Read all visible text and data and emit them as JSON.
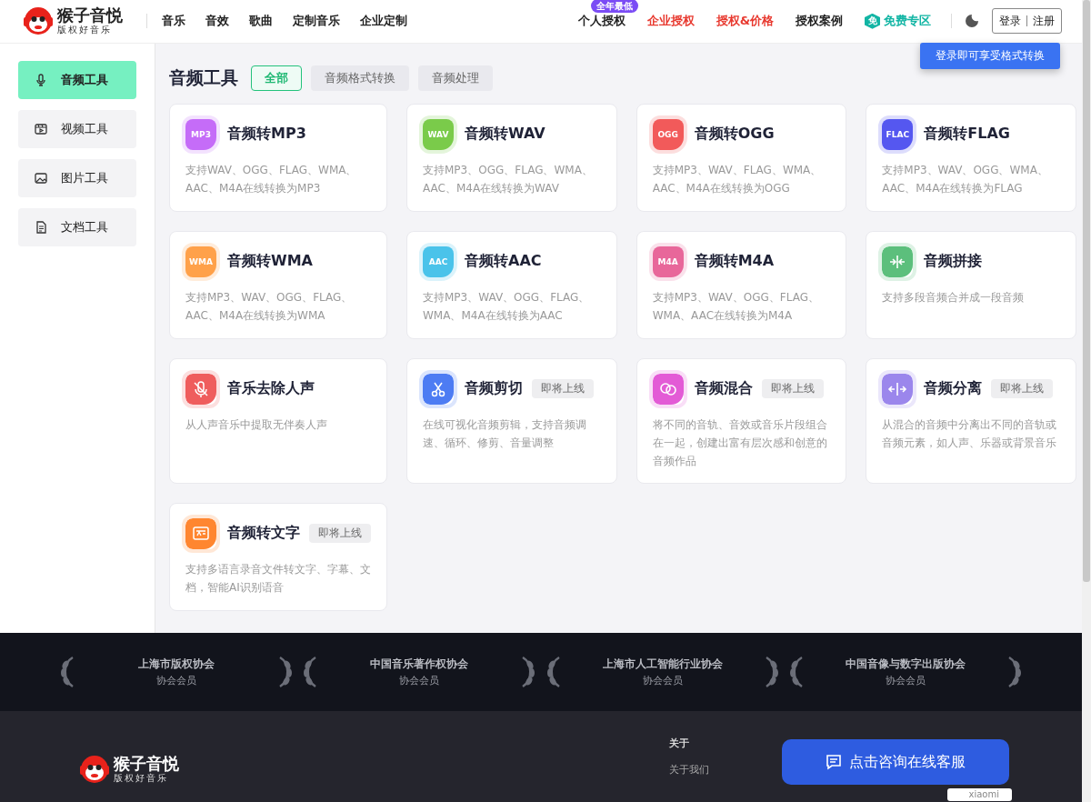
{
  "header": {
    "logo": {
      "name": "猴子音悦",
      "slogan": "版权好音乐"
    },
    "nav": [
      "音乐",
      "音效",
      "歌曲",
      "定制音乐",
      "企业定制"
    ],
    "right_nav": [
      {
        "label": "个人授权",
        "color": "#222222",
        "badge": "全年最低"
      },
      {
        "label": "企业授权",
        "color": "#e8392f"
      },
      {
        "label": "授权&价格",
        "color": "#e8392f"
      },
      {
        "label": "授权案例",
        "color": "#222222"
      },
      {
        "label": "免费专区",
        "color": "#12b5a4",
        "icon_text": "免"
      }
    ],
    "login": "登录",
    "register": "注册",
    "tooltip": "登录即可享受格式转换"
  },
  "sidebar": {
    "items": [
      {
        "label": "音频工具",
        "selected": true
      },
      {
        "label": "视频工具",
        "selected": false
      },
      {
        "label": "图片工具",
        "selected": false
      },
      {
        "label": "文档工具",
        "selected": false
      }
    ]
  },
  "main": {
    "title": "音频工具",
    "filters": [
      {
        "label": "全部",
        "selected": true
      },
      {
        "label": "音频格式转换",
        "selected": false
      },
      {
        "label": "音频处理",
        "selected": false
      }
    ],
    "tools": [
      {
        "kind": "format",
        "badge": "MP3",
        "color": "#c56cf8",
        "title": "音频转MP3",
        "description": "支持WAV、OGG、FLAG、WMA、AAC、M4A在线转换为MP3"
      },
      {
        "kind": "format",
        "badge": "WAV",
        "color": "#7acb4a",
        "title": "音频转WAV",
        "description": "支持MP3、OGG、FLAG、WMA、AAC、M4A在线转换为WAV"
      },
      {
        "kind": "format",
        "badge": "OGG",
        "color": "#f25a5a",
        "title": "音频转OGG",
        "description": "支持MP3、WAV、FLAG、WMA、AAC、M4A在线转换为OGG"
      },
      {
        "kind": "format",
        "badge": "FLAC",
        "color": "#5557f0",
        "title": "音频转FLAG",
        "description": "支持MP3、WAV、OGG、WMA、AAC、M4A在线转换为FLAG"
      },
      {
        "kind": "format",
        "badge": "WMA",
        "color": "#ffa14a",
        "title": "音频转WMA",
        "description": "支持MP3、WAV、OGG、FLAG、AAC、M4A在线转换为WMA"
      },
      {
        "kind": "format",
        "badge": "AAC",
        "color": "#4ac3ea",
        "title": "音频转AAC",
        "description": "支持MP3、WAV、OGG、FLAG、WMA、M4A在线转换为AAC"
      },
      {
        "kind": "format",
        "badge": "M4A",
        "color": "#e8679a",
        "title": "音频转M4A",
        "description": "支持MP3、WAV、OGG、FLAG、WMA、AAC在线转换为M4A"
      },
      {
        "kind": "splice",
        "color": "#5cbf7c",
        "title": "音频拼接",
        "description": "支持多段音频合并成一段音频"
      },
      {
        "kind": "vocal-remove",
        "color": "#ef5d5d",
        "title": "音乐去除人声",
        "description": "从人声音乐中提取无伴奏人声"
      },
      {
        "kind": "cut",
        "color": "#4d7cf3",
        "title": "音频剪切",
        "status": "即将上线",
        "description": "在线可视化音频剪辑，支持音频调速、循环、修剪、音量调整"
      },
      {
        "kind": "mix",
        "color": "#e35bd6",
        "title": "音频混合",
        "status": "即将上线",
        "description": "将不同的音轨、音效或音乐片段组合在一起，创建出富有层次感和创意的音频作品"
      },
      {
        "kind": "separate",
        "color": "#9b86ec",
        "title": "音频分离",
        "status": "即将上线",
        "description": "从混合的音频中分离出不同的音轨或音频元素，如人声、乐器或背景音乐"
      },
      {
        "kind": "transcribe",
        "color": "#ff8630",
        "title": "音频转文字",
        "status": "即将上线",
        "description": "支持多语言录音文件转文字、字幕、文档，智能AI识别语音"
      }
    ]
  },
  "footer": {
    "associations": [
      {
        "name": "上海市版权协会",
        "note": "协会会员"
      },
      {
        "name": "中国音乐著作权协会",
        "note": "协会会员"
      },
      {
        "name": "上海市人工智能行业协会",
        "note": "协会会员"
      },
      {
        "name": "中国音像与数字出版协会",
        "note": "协会会员"
      }
    ],
    "logo": {
      "name": "猴子音悦",
      "slogan": "版权好音乐"
    },
    "links": {
      "heading": "关于",
      "items": [
        "关于我们"
      ]
    },
    "partner": "xiaomi",
    "chat_button": "点击咨询在线客服"
  }
}
